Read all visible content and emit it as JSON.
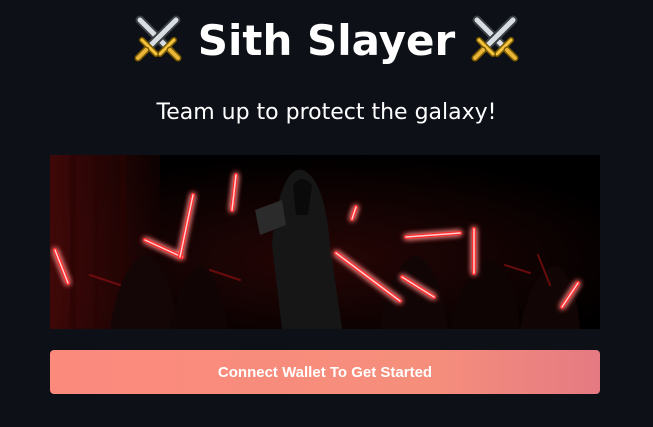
{
  "header": {
    "title": "Sith Slayer",
    "left_icon": "crossed-swords-icon",
    "right_icon": "crossed-swords-icon"
  },
  "subtitle": "Team up to protect the galaxy!",
  "banner": {
    "description_icon": "sith-lightsabers-image"
  },
  "cta": {
    "label": "Connect Wallet To Get Started"
  },
  "colors": {
    "background": "#0d1117",
    "button_start": "#fb8a7d",
    "button_end": "#e57a82",
    "saber_red": "#ff2a2a"
  }
}
